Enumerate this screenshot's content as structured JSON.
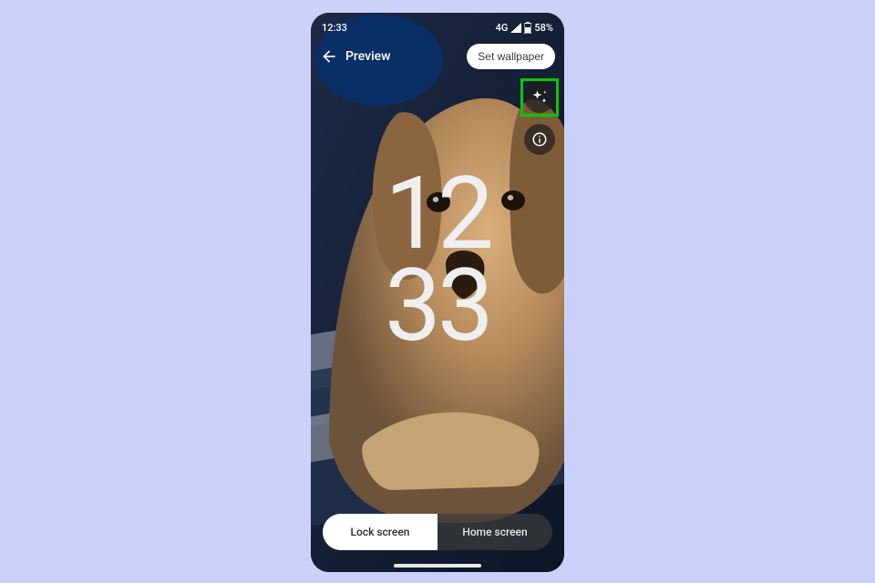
{
  "statusbar": {
    "time": "12:33",
    "network": "4G",
    "battery_pct": "58%"
  },
  "toolbar": {
    "title": "Preview",
    "set_wallpaper_label": "Set wallpaper"
  },
  "side_buttons": {
    "effects": "effects",
    "info": "info"
  },
  "clock": {
    "hours": "12",
    "minutes": "33"
  },
  "tabs": {
    "lock": "Lock screen",
    "home": "Home screen",
    "active": "lock"
  },
  "wallpaper": {
    "description": "Photo of a tan Labrador dog lying on navy striped bedding"
  },
  "highlight": {
    "target": "effects-button"
  }
}
